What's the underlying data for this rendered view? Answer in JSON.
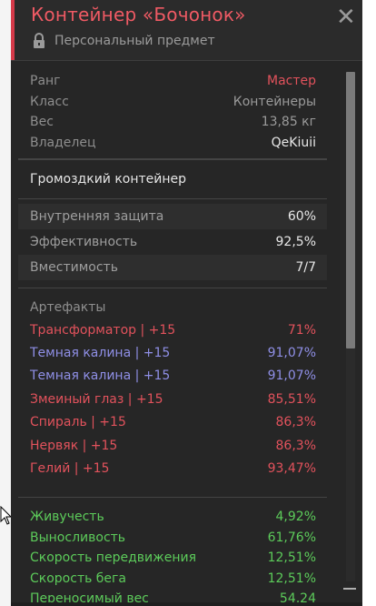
{
  "header": {
    "title": "Контейнер «Бочонок»",
    "subtitle": "Персональный предмет",
    "accent_color": "#d63a4a",
    "close_icon": "close-icon",
    "lock_icon": "lock-icon"
  },
  "props": [
    {
      "label": "Ранг",
      "value": "Мастер",
      "color": "#e2525c"
    },
    {
      "label": "Класс",
      "value": "Контейнеры",
      "color": "#9a9a9a"
    },
    {
      "label": "Вес",
      "value": "13,85 кг",
      "color": "#9a9a9a"
    },
    {
      "label": "Владелец",
      "value": "QeKiuii",
      "color": "#e8e8e8"
    }
  ],
  "item_type": "Громоздкий контейнер",
  "defense": [
    {
      "label": "Внутренняя защита",
      "value": "60%"
    },
    {
      "label": "Эффективность",
      "value": "92,5%"
    },
    {
      "label": "Вместимость",
      "value": "7/7"
    }
  ],
  "artifacts": {
    "heading": "Артефакты",
    "items": [
      {
        "label": "Трансформатор | +15",
        "value": "71%",
        "color": "#e2525c"
      },
      {
        "label": "Темная калина | +15",
        "value": "91,07%",
        "color": "#8f8fe6"
      },
      {
        "label": "Темная калина | +15",
        "value": "91,07%",
        "color": "#8f8fe6"
      },
      {
        "label": "Змеиный глаз | +15",
        "value": "85,51%",
        "color": "#e2525c"
      },
      {
        "label": "Спираль | +15",
        "value": "86,3%",
        "color": "#e2525c"
      },
      {
        "label": "Нервяк | +15",
        "value": "86,3%",
        "color": "#e2525c"
      },
      {
        "label": "Гелий | +15",
        "value": "93,47%",
        "color": "#e2525c"
      }
    ]
  },
  "stats": [
    {
      "label": "Живучесть",
      "value": "4,92%"
    },
    {
      "label": "Выносливость",
      "value": "61,76%"
    },
    {
      "label": "Скорость передвижения",
      "value": "12,51%"
    },
    {
      "label": "Скорость бега",
      "value": "12,51%"
    },
    {
      "label": "Переносимый вес",
      "value": "54,24"
    }
  ],
  "colors": {
    "stat_green": "#5ccb5a",
    "panel_bg": "#262626"
  }
}
